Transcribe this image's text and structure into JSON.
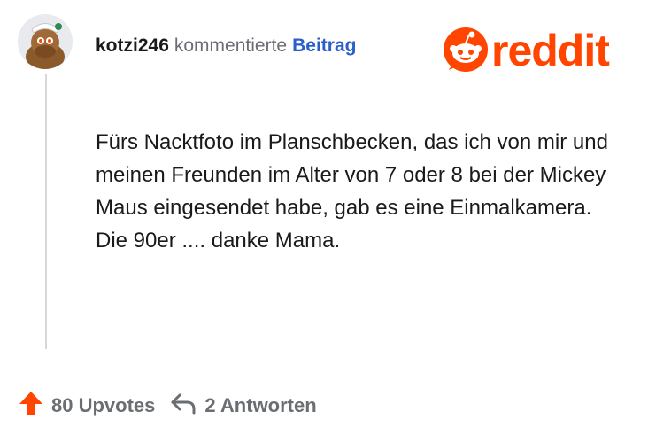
{
  "comment": {
    "username": "kotzi246",
    "action": "kommentierte",
    "target": "Beitrag",
    "body": "Fürs Nacktfoto im Planschbecken, das ich von mir und meinen Freunden im Alter von 7 oder 8 bei der Mickey Maus eingesendet habe, gab es eine Einmalkamera. Die 90er .... danke Mama."
  },
  "brand": {
    "wordmark": "reddit",
    "color": "#ff4500"
  },
  "footer": {
    "upvotes_label": "80 Upvotes",
    "replies_label": "2 Antworten"
  },
  "icons": [
    "avatar",
    "reddit-snoo-icon",
    "upvote-arrow-icon",
    "reply-arrow-icon"
  ]
}
